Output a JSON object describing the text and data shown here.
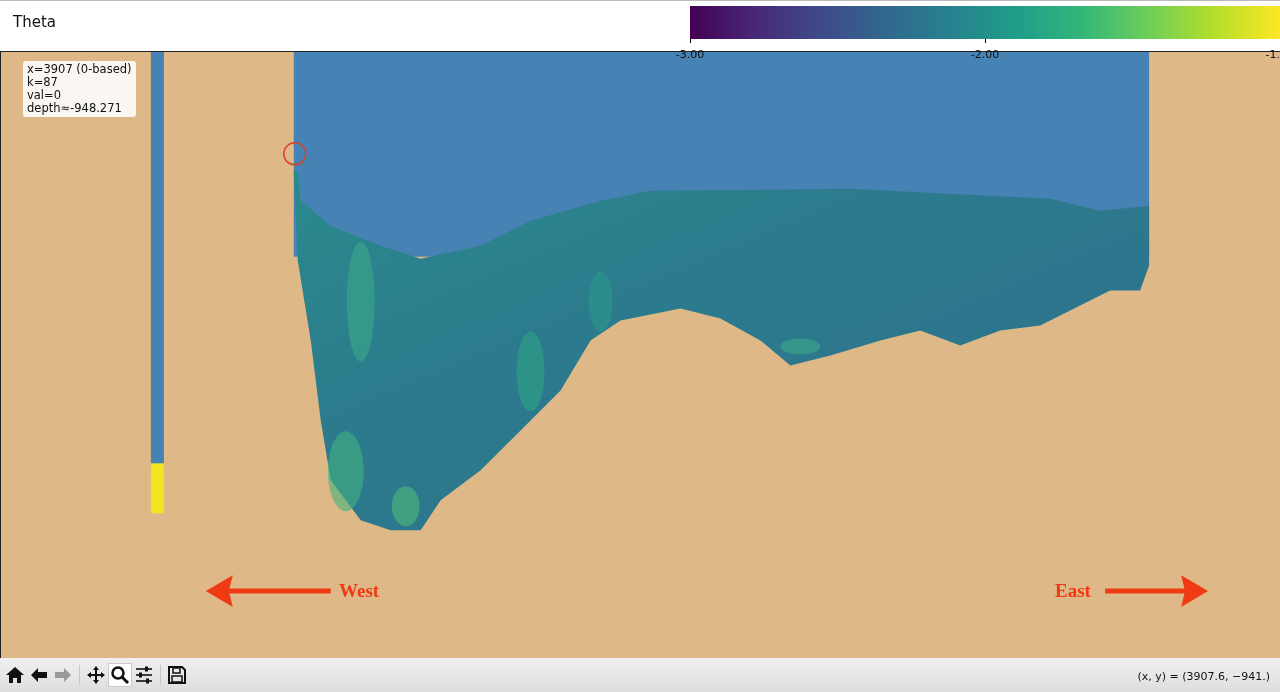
{
  "figure": {
    "title": "Theta",
    "colorbar": {
      "ticks": [
        "-3.00",
        "-2.00",
        "-1."
      ]
    },
    "annotation": {
      "lines": [
        "x=3907 (0-based)",
        "k=87",
        "val=0",
        "depth≈-948.271"
      ]
    },
    "labels": [
      {
        "kind": "west",
        "text": "West"
      },
      {
        "kind": "east",
        "text": "East"
      }
    ]
  },
  "toolbar": {
    "buttons": [
      {
        "kind": "home",
        "selected": false,
        "disabled": false
      },
      {
        "kind": "back",
        "selected": false,
        "disabled": false
      },
      {
        "kind": "forward",
        "selected": false,
        "disabled": true
      },
      {
        "kind": "pan",
        "selected": false,
        "disabled": false
      },
      {
        "kind": "zoom",
        "selected": true,
        "disabled": false
      },
      {
        "kind": "configure",
        "selected": false,
        "disabled": false
      },
      {
        "kind": "save",
        "selected": false,
        "disabled": false
      }
    ]
  },
  "status_bar": "(x, y) = (3907.6, −941.)"
}
